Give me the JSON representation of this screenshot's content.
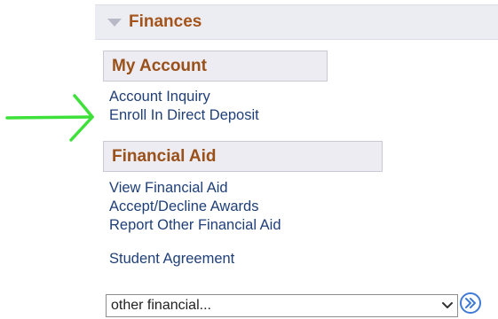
{
  "finances": {
    "title": "Finances"
  },
  "my_account": {
    "title": "My Account",
    "links": [
      "Account Inquiry",
      "Enroll In Direct Deposit"
    ]
  },
  "financial_aid": {
    "title": "Financial Aid",
    "links": [
      "View Financial Aid",
      "Accept/Decline Awards",
      "Report Other Financial Aid"
    ]
  },
  "student_agreement": {
    "label": "Student Agreement"
  },
  "other_select": {
    "selected": "other financial..."
  },
  "colors": {
    "section_title": "#a4541a",
    "link": "#1f3f78",
    "annotation_arrow": "#3ee03a",
    "go_button": "#3f7ad8"
  },
  "icons": {
    "collapse": "triangle-down-icon",
    "dropdown": "chevron-down-icon",
    "go": "double-chevron-right-icon",
    "annotation": "arrow-right-icon"
  }
}
